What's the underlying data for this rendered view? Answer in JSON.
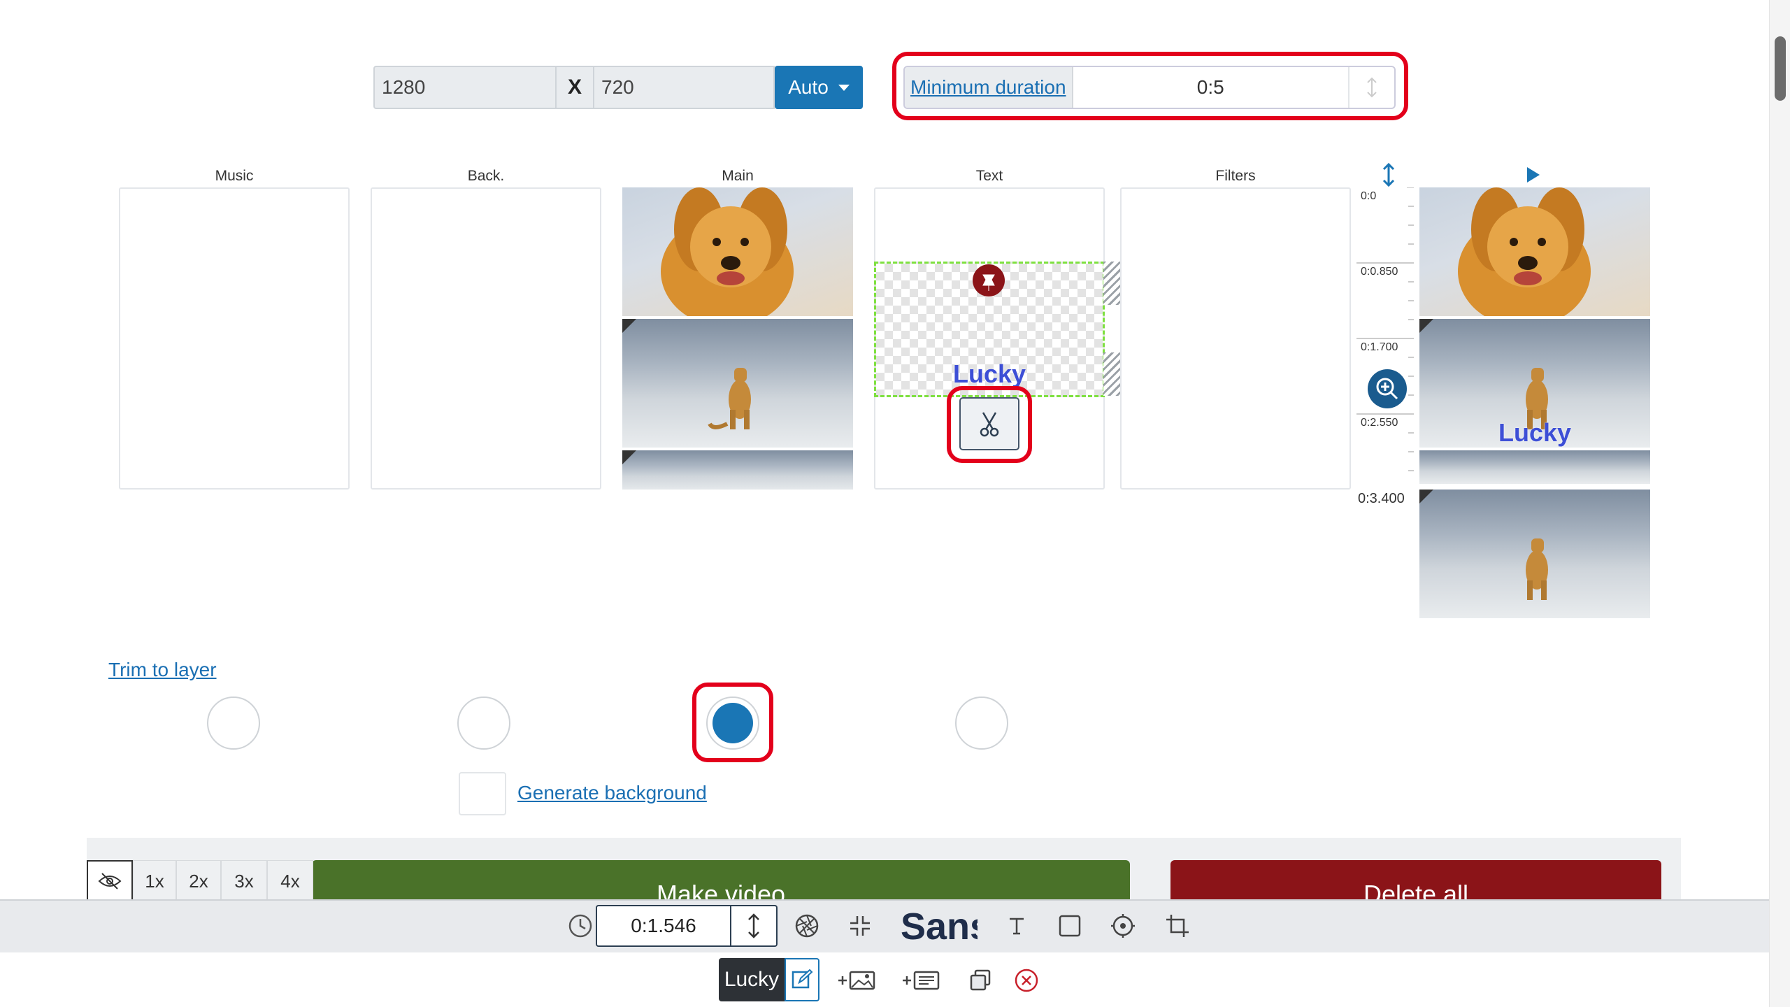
{
  "dimensions": {
    "width": "1280",
    "separator": "X",
    "height": "720",
    "auto_label": "Auto"
  },
  "min_duration": {
    "label": "Minimum duration",
    "value": "0:5"
  },
  "columns": {
    "music": "Music",
    "back": "Back.",
    "main": "Main",
    "text": "Text",
    "filters": "Filters"
  },
  "ruler": {
    "ticks": [
      "0:0",
      "0:0.850",
      "0:1.700",
      "0:2.550",
      "0:3.400"
    ]
  },
  "text_layer": {
    "text": "Lucky"
  },
  "preview": {
    "overlay_text": "Lucky"
  },
  "trim": {
    "link": "Trim to layer"
  },
  "generate": {
    "link": "Generate background"
  },
  "multipliers": [
    "1x",
    "2x",
    "3x",
    "4x"
  ],
  "actions": {
    "make_video": "Make video",
    "delete_all": "Delete all"
  },
  "toolbar": {
    "time_value": "0:1.546",
    "font_preview": "Sans"
  },
  "layer_bar": {
    "layer_name": "Lucky"
  },
  "colors": {
    "accent": "#1a76b5",
    "highlight": "#e3001b",
    "make_video": "#4a7229",
    "delete_all": "#8b1418"
  }
}
